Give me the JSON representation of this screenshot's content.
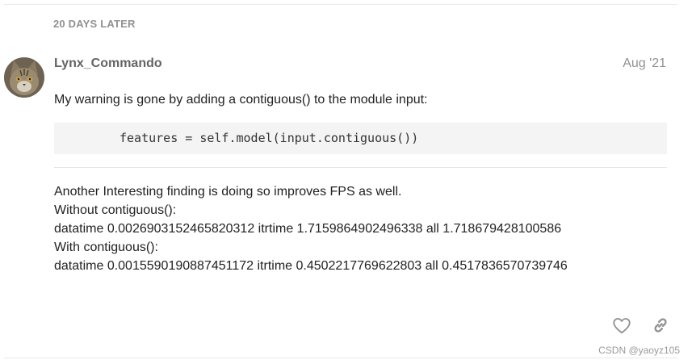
{
  "time_gap": "20 DAYS LATER",
  "post": {
    "username": "Lynx_Commando",
    "date": "Aug '21",
    "avatar_icon": "cat-avatar",
    "intro": "My warning is gone by adding a contiguous() to the module input:",
    "code": "features = self.model(input.contiguous())",
    "body_lines": [
      "Another Interesting finding is doing so improves FPS as well.",
      "Without contiguous():",
      "datatime 0.0026903152465820312 itrtime 1.7159864902496338 all 1.718679428100586",
      "With contiguous():",
      "datatime 0.0015590190887451172 itrtime 0.4502217769622803 all 0.4517836570739746"
    ]
  },
  "actions": {
    "like_icon": "heart-icon",
    "share_icon": "link-icon"
  },
  "watermark": "CSDN @yaoyz105",
  "colors": {
    "muted": "#919191",
    "username": "#646464",
    "code_bg": "#f4f4f4",
    "icon": "#919191"
  }
}
